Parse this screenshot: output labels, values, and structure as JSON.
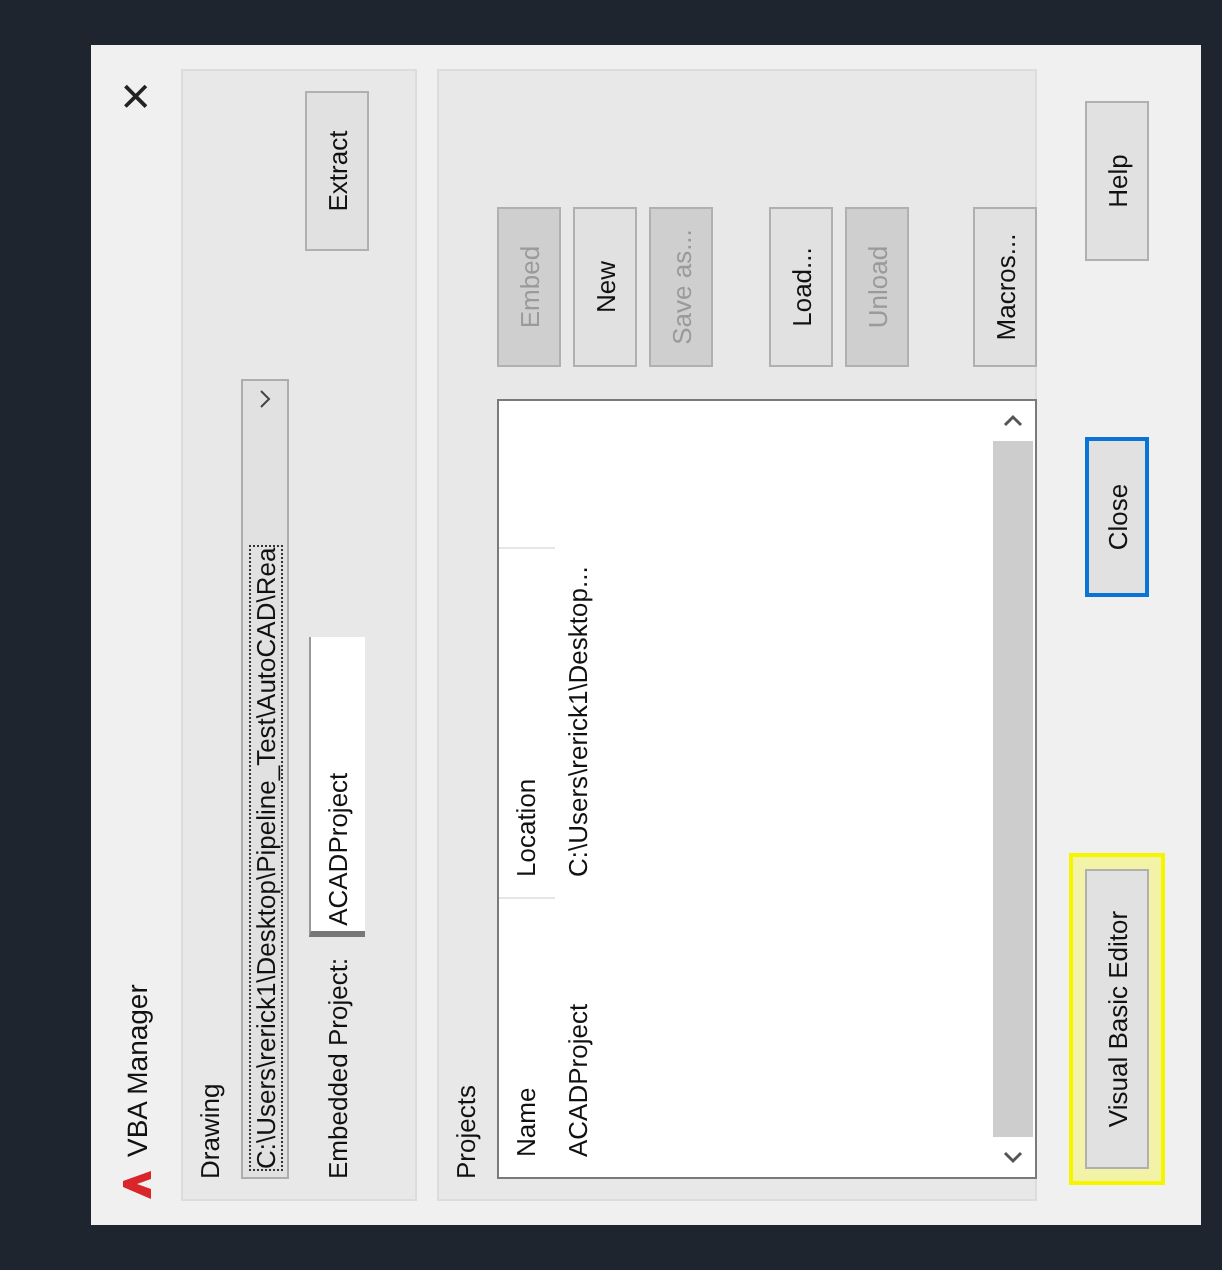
{
  "window": {
    "title": "VBA Manager",
    "close": "×"
  },
  "drawing": {
    "label": "Drawing",
    "path": "C:\\Users\\rerick1\\Desktop\\Pipeline_Test\\AutoCAD\\Rea",
    "extract": "Extract",
    "embedded_label": "Embedded Project:",
    "embedded_value": "ACADProject"
  },
  "projects": {
    "label": "Projects",
    "list_columns": [
      {
        "header": "Name",
        "entries": [
          "ACADProject"
        ]
      },
      {
        "header": "Location",
        "entries": [
          "C:\\Users\\rerick1\\Desktop..."
        ]
      }
    ],
    "buttons": [
      {
        "label": "Embed",
        "disabled": true
      },
      {
        "label": "New",
        "disabled": false
      },
      {
        "label": "Save as...",
        "disabled": true
      },
      {
        "label": "Load...",
        "disabled": false
      },
      {
        "label": "Unload",
        "disabled": true
      },
      {
        "label": "Macros...",
        "disabled": false
      }
    ]
  },
  "footer": [
    {
      "label": "Visual Basic Editor",
      "highlighted": true,
      "focused": false
    },
    {
      "label": "Close",
      "highlighted": false,
      "focused": true
    },
    {
      "label": "Help",
      "highlighted": false,
      "focused": false
    }
  ]
}
